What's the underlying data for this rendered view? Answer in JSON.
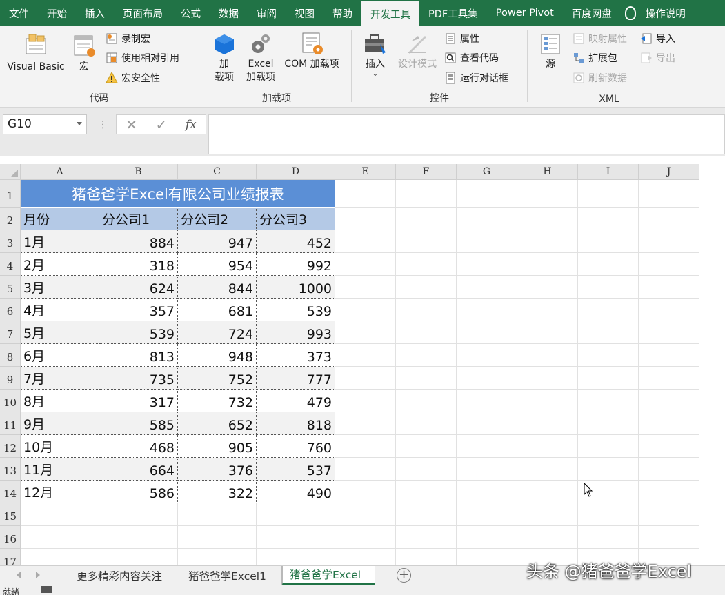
{
  "menu": {
    "tabs": [
      "文件",
      "开始",
      "插入",
      "页面布局",
      "公式",
      "数据",
      "审阅",
      "视图",
      "帮助",
      "开发工具",
      "PDF工具集",
      "Power Pivot",
      "百度网盘"
    ],
    "active": "开发工具",
    "help_search": "操作说明"
  },
  "ribbon": {
    "code": {
      "label": "代码",
      "visual_basic": "Visual Basic",
      "macros": "宏",
      "record": "录制宏",
      "relative": "使用相对引用",
      "security": "宏安全性"
    },
    "addins": {
      "label": "加载项",
      "addins": "加\n载项",
      "excel_addins": "Excel\n加载项",
      "com_addins": "COM 加载项"
    },
    "controls": {
      "label": "控件",
      "insert": "插入",
      "design": "设计模式",
      "properties": "属性",
      "view_code": "查看代码",
      "dialog": "运行对话框"
    },
    "xml": {
      "label": "XML",
      "source": "源",
      "map_props": "映射属性",
      "expansion": "扩展包",
      "refresh": "刷新数据",
      "import": "导入",
      "export": "导出"
    }
  },
  "formula": {
    "name_box": "G10",
    "value": ""
  },
  "columns": [
    "A",
    "B",
    "C",
    "D",
    "E",
    "F",
    "G",
    "H",
    "I",
    "J"
  ],
  "rows": [
    "1",
    "2",
    "3",
    "4",
    "5",
    "6",
    "7",
    "8",
    "9",
    "10",
    "11",
    "12",
    "13",
    "14",
    "15",
    "16",
    "17"
  ],
  "table": {
    "title": "猪爸爸学Excel有限公司业绩报表",
    "headers": [
      "月份",
      "分公司1",
      "分公司2",
      "分公司3"
    ],
    "data": [
      [
        "1月",
        "884",
        "947",
        "452"
      ],
      [
        "2月",
        "318",
        "954",
        "992"
      ],
      [
        "3月",
        "624",
        "844",
        "1000"
      ],
      [
        "4月",
        "357",
        "681",
        "539"
      ],
      [
        "5月",
        "539",
        "724",
        "993"
      ],
      [
        "6月",
        "813",
        "948",
        "373"
      ],
      [
        "7月",
        "735",
        "752",
        "777"
      ],
      [
        "8月",
        "317",
        "732",
        "479"
      ],
      [
        "9月",
        "585",
        "652",
        "818"
      ],
      [
        "10月",
        "468",
        "905",
        "760"
      ],
      [
        "11月",
        "664",
        "376",
        "537"
      ],
      [
        "12月",
        "586",
        "322",
        "490"
      ]
    ]
  },
  "sheets": [
    "更多精彩内容关注",
    "猪爸爸学Excel1",
    "猪爸爸学Excel"
  ],
  "active_sheet": "猪爸爸学Excel",
  "watermark": "头条 @猪爸爸学Excel",
  "status": "就绪",
  "colors": {
    "accent": "#217346",
    "title_fill": "#5b8fd6",
    "header_fill": "#b4c9e6"
  }
}
